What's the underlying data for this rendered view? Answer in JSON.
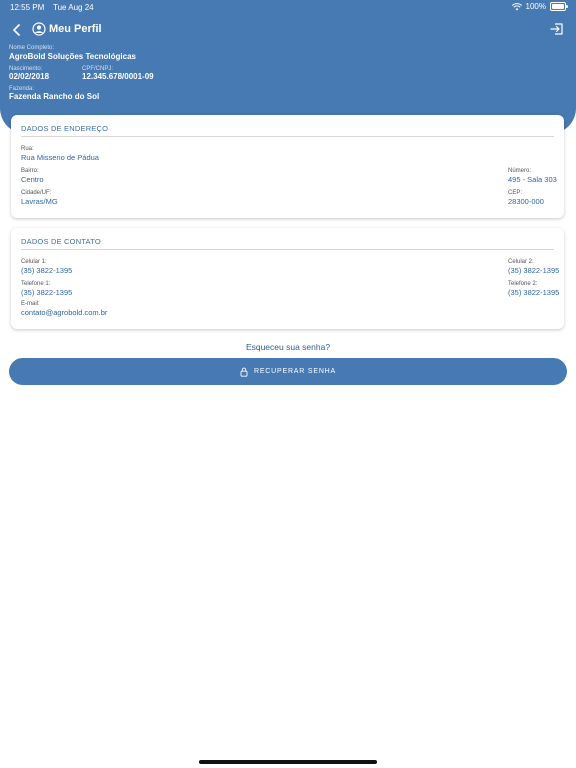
{
  "status_bar": {
    "time": "12:55 PM",
    "date": "Tue Aug 24",
    "battery": "100%"
  },
  "nav": {
    "title": "Meu Perfil"
  },
  "profile": {
    "nome_label": "Nome Completo:",
    "nome_value": "AgroBold Soluções Tecnológicas",
    "nascimento_label": "Nascimento:",
    "nascimento_value": "02/02/2018",
    "cpf_label": "CPF/CNPJ:",
    "cpf_value": "12.345.678/0001-09",
    "fazenda_label": "Fazenda:",
    "fazenda_value": "Fazenda Rancho do Sol"
  },
  "endereco": {
    "title": "DADOS DE ENDEREÇO",
    "rua_label": "Rua:",
    "rua_value": "Rua Misseno de Pádua",
    "bairro_label": "Bairro:",
    "bairro_value": "Centro",
    "numero_label": "Número:",
    "numero_value": "495 - Sala 303",
    "cidade_label": "Cidade/UF:",
    "cidade_value": "Lavras/MG",
    "cep_label": "CEP:",
    "cep_value": "28300-000"
  },
  "contato": {
    "title": "DADOS DE CONTATO",
    "cel1_label": "Celular 1:",
    "cel1_value": "(35) 3822-1395",
    "cel2_label": "Celular 2:",
    "cel2_value": "(35) 3822-1395",
    "tel1_label": "Telefone 1:",
    "tel1_value": "(35) 3822-1395",
    "tel2_label": "Telefone 2:",
    "tel2_value": "(35) 3822-1395",
    "email_label": "E-mail:",
    "email_value": "contato@agrobold.com.br"
  },
  "actions": {
    "forgot_text": "Esqueceu sua senha?",
    "recover_label": "RECUPERAR SENHA"
  },
  "icons": [
    "wifi-icon",
    "battery-icon",
    "back-arrow-icon",
    "user-circle-icon",
    "logout-icon",
    "lock-icon"
  ],
  "colors": {
    "primary": "#4779b3",
    "text_blue": "#2f65a6"
  }
}
